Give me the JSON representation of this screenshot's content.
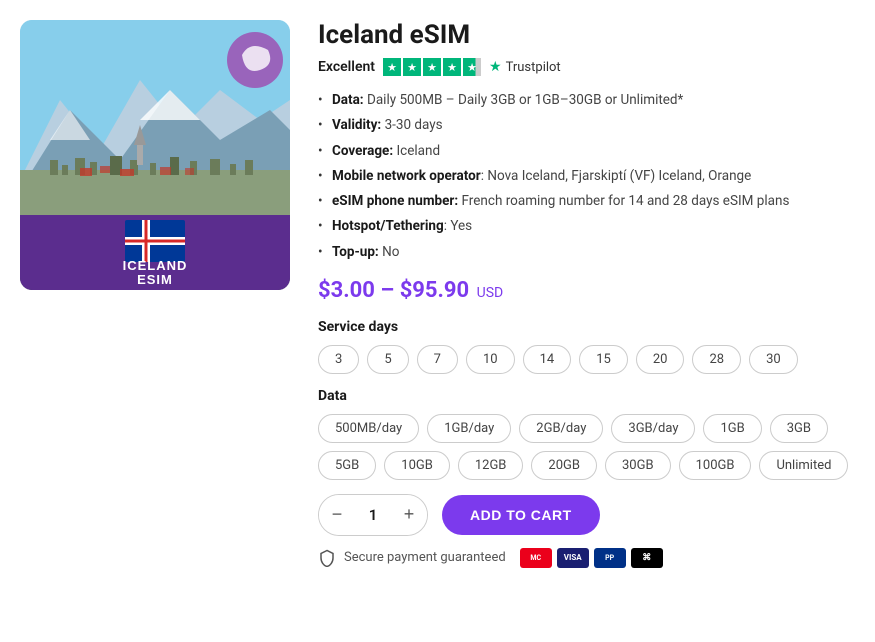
{
  "product": {
    "title": "Iceland eSIM",
    "rating_label": "Excellent",
    "trustpilot": "Trustpilot",
    "price_from": "$3.00",
    "price_to": "$95.90",
    "currency": "USD",
    "specs": [
      {
        "key": "Data",
        "value": "Daily 500MB – Daily 3GB or 1GB–30GB or Unlimited*"
      },
      {
        "key": "Validity",
        "value": "3-30 days"
      },
      {
        "key": "Coverage",
        "value": "Iceland"
      },
      {
        "key": "Mobile network operator",
        "value": "Nova Iceland, Fjarskiptí (VF) Iceland, Orange"
      },
      {
        "key": "eSIM phone number",
        "value": "French roaming number for 14 and 28 days eSIM plans"
      },
      {
        "key": "Hotspot/Tethering",
        "value": "Yes"
      },
      {
        "key": "Top-up",
        "value": "No"
      }
    ],
    "service_days_label": "Service days",
    "service_days": [
      "3",
      "5",
      "7",
      "10",
      "14",
      "15",
      "20",
      "28",
      "30"
    ],
    "data_label": "Data",
    "data_options": [
      "500MB/day",
      "1GB/day",
      "2GB/day",
      "3GB/day",
      "1GB",
      "3GB",
      "5GB",
      "10GB",
      "12GB",
      "20GB",
      "30GB",
      "100GB",
      "Unlimited"
    ],
    "quantity": "1",
    "add_to_cart_label": "ADD TO CART",
    "minus_label": "−",
    "plus_label": "+",
    "secure_payment_label": "Secure payment guaranteed",
    "image_alt_text": "ICELAND ESIM",
    "image_line1": "ICELAND",
    "image_line2": "ESIM"
  }
}
